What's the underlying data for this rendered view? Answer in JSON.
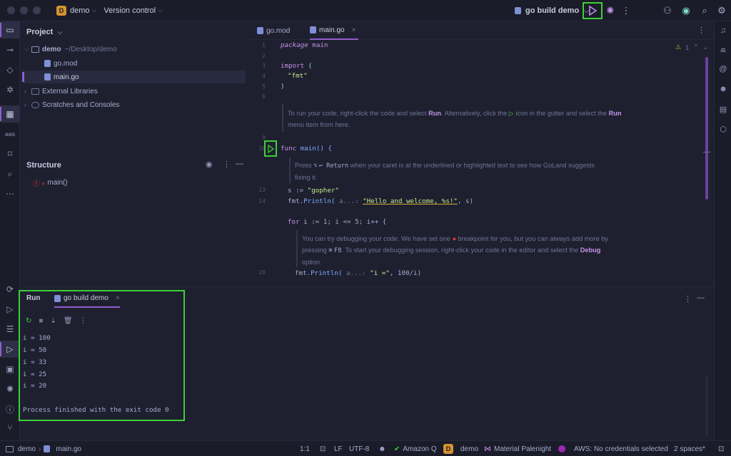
{
  "titlebar": {
    "project_badge": "D",
    "project_name": "demo",
    "vcs_label": "Version control",
    "run_config": "go build demo"
  },
  "project_panel": {
    "title": "Project",
    "root_name": "demo",
    "root_path": "~/Desktop/demo",
    "files": [
      "go.mod",
      "main.go"
    ],
    "external_libraries": "External Libraries",
    "scratches": "Scratches and Consoles"
  },
  "structure_panel": {
    "title": "Structure",
    "item": "main()"
  },
  "editor": {
    "tabs": [
      "go.mod",
      "main.go"
    ],
    "inspection_count": "1",
    "line_numbers": [
      "1",
      "2",
      "3",
      "4",
      "5",
      "6",
      "9",
      "10",
      "13",
      "14",
      "20"
    ],
    "code": {
      "package_kw": "package",
      "package_name": "main",
      "import_kw": "import",
      "import_open": "(",
      "import_fmt": "\"fmt\"",
      "import_close": ")",
      "func_kw": "func",
      "func_sig": "main() {",
      "s_assign": "s := ",
      "s_value": "\"gopher\"",
      "println_pkg": "fmt.",
      "println_fn": "Println(",
      "println_hint": "a...:",
      "println_str": "\"Hello and welcome, %s!\"",
      "println_tail": ", s)",
      "for_kw": "for",
      "for_body": "i := 1; i <= 5; i++ {",
      "println2_hint": "a...:",
      "println2_str": "\"i =\"",
      "println2_tail": ", 100/i)"
    },
    "doc1": {
      "a": "To run your code, right-click the code and select ",
      "b": "Run",
      "c": ". Alternatively, click the ",
      "d": " icon in the gutter and select the ",
      "e": "Run",
      "f": " menu item from here."
    },
    "doc2": {
      "a": "Press ",
      "key1": "⌥",
      "key2": "↩ Return",
      "b": " when your caret is at the underlined or highlighted text to see how GoLand suggests fixing it."
    },
    "doc3": {
      "a": "You can try debugging your code. We have set one ",
      "b": " breakpoint for you, but you can always add more by pressing ",
      "key1": "⌘",
      "key2": "F8",
      "c": ". To start your debugging session, right-click your code in the editor and select the ",
      "d": "Debug",
      "e": " option."
    }
  },
  "run_panel": {
    "tab_run": "Run",
    "tab_config": "go build demo",
    "output": [
      "i = 100",
      "i = 50",
      "i = 33",
      "i = 25",
      "i = 20"
    ],
    "finish": "Process finished with the exit code 0"
  },
  "statusbar": {
    "breadcrumb_project": "demo",
    "breadcrumb_file": "main.go",
    "position": "1:1",
    "line_sep": "LF",
    "encoding": "UTF-8",
    "amazon_q": "Amazon Q",
    "project_badge": "D",
    "project": "demo",
    "theme": "Material Palenight",
    "aws": "AWS: No credentials selected",
    "indent": "2 spaces*"
  },
  "colors": {
    "highlight_box": "#3ecf37",
    "accent": "#8f5fcc",
    "run_green": "#3ecf37",
    "breakpoint_red": "#e53935"
  }
}
